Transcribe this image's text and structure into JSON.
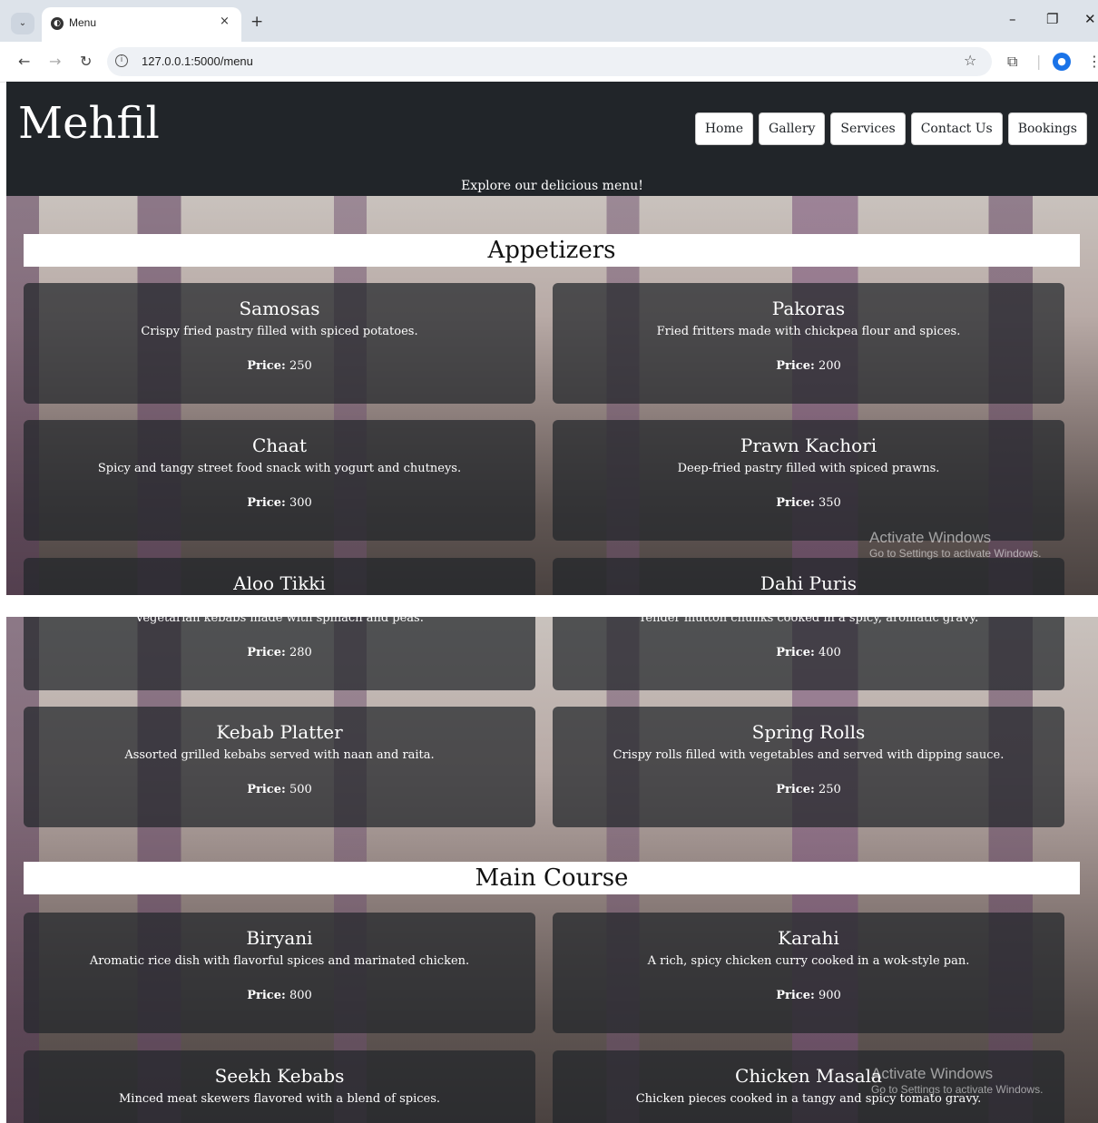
{
  "browser": {
    "tab_title": "Menu",
    "tab_close": "×",
    "new_tab": "+",
    "url": "127.0.0.1:5000/menu",
    "icons": [
      "tab-search-icon",
      "favicon-icon",
      "back-icon",
      "forward-icon",
      "reload-icon",
      "info-icon",
      "star-icon",
      "extensions-icon",
      "profile-icon",
      "more-icon",
      "minimize-icon",
      "restore-icon",
      "close-window-icon"
    ]
  },
  "site": {
    "brand": "Mehfil",
    "nav": [
      "Home",
      "Gallery",
      "Services",
      "Contact Us",
      "Bookings"
    ],
    "tagline": "Explore our delicious menu!"
  },
  "price_label": "Price:",
  "appetizers": {
    "title": "Appetizers",
    "items": [
      {
        "name": "Samosas",
        "desc": "Crispy fried pastry filled with spiced potatoes.",
        "price": "250"
      },
      {
        "name": "Pakoras",
        "desc": "Fried fritters made with chickpea flour and spices.",
        "price": "200"
      },
      {
        "name": "Chaat",
        "desc": "Spicy and tangy street food snack with yogurt and chutneys.",
        "price": "300"
      },
      {
        "name": "Prawn Kachori",
        "desc": "Deep-fried pastry filled with spiced prawns.",
        "price": "350"
      },
      {
        "name": "Aloo Tikki",
        "desc": "",
        "price": ""
      },
      {
        "name": "Dahi Puris",
        "desc": "",
        "price": ""
      }
    ]
  },
  "scrolled": {
    "partial_items": [
      {
        "desc": "Vegetarian kebabs made with spinach and peas.",
        "price": "280"
      },
      {
        "desc": "Tender mutton chunks cooked in a spicy, aromatic gravy.",
        "price": "400"
      }
    ],
    "items": [
      {
        "name": "Kebab Platter",
        "desc": "Assorted grilled kebabs served with naan and raita.",
        "price": "500"
      },
      {
        "name": "Spring Rolls",
        "desc": "Crispy rolls filled with vegetables and served with dipping sauce.",
        "price": "250"
      }
    ]
  },
  "main_course": {
    "title": "Main Course",
    "items": [
      {
        "name": "Biryani",
        "desc": "Aromatic rice dish with flavorful spices and marinated chicken.",
        "price": "800"
      },
      {
        "name": "Karahi",
        "desc": "A rich, spicy chicken curry cooked in a wok-style pan.",
        "price": "900"
      },
      {
        "name": "Seekh Kebabs",
        "desc": "Minced meat skewers flavored with a blend of spices.",
        "price": ""
      },
      {
        "name": "Chicken Masala",
        "desc": "Chicken pieces cooked in a tangy and spicy tomato gravy.",
        "price": ""
      }
    ]
  },
  "watermark": {
    "title": "Activate Windows",
    "subtitle": "Go to Settings to activate Windows."
  },
  "colors": {
    "header_bg": "#212529",
    "card_bg": "rgba(33,37,41,0.72)"
  }
}
